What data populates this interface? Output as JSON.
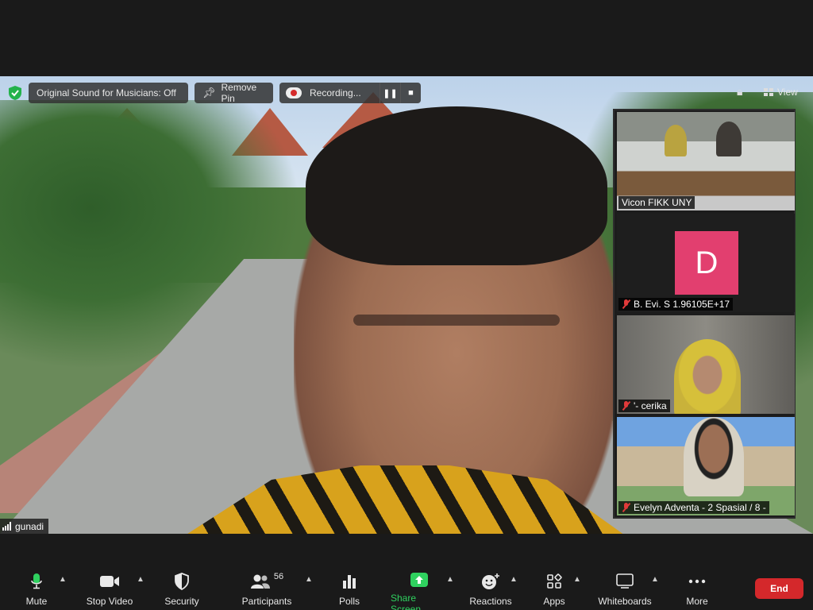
{
  "top_bar": {
    "sound_label": "Original Sound for Musicians: Off",
    "remove_pin_label": "Remove Pin",
    "recording_label": "Recording...",
    "view_label": "View"
  },
  "main_speaker": {
    "name": "gunadi"
  },
  "thumbnails": [
    {
      "name": "Vicon FIKK UNY",
      "muted": false
    },
    {
      "name": "B. Evi. S 1.96105E+17",
      "muted": true,
      "avatar_letter": "D",
      "avatar_color": "#e23f6f"
    },
    {
      "name": "'- cerika",
      "muted": true
    },
    {
      "name": "Evelyn Adventa - 2 Spasial / 8 -",
      "muted": true
    }
  ],
  "toolbar": {
    "mute_label": "Mute",
    "stop_video_label": "Stop Video",
    "security_label": "Security",
    "participants_label": "Participants",
    "participants_count": "56",
    "polls_label": "Polls",
    "share_screen_label": "Share Screen",
    "reactions_label": "Reactions",
    "apps_label": "Apps",
    "whiteboards_label": "Whiteboards",
    "more_label": "More",
    "end_label": "End"
  },
  "colors": {
    "share_green": "#2fd15f",
    "end_red": "#d4282b",
    "mic_green": "#2fd15f"
  }
}
